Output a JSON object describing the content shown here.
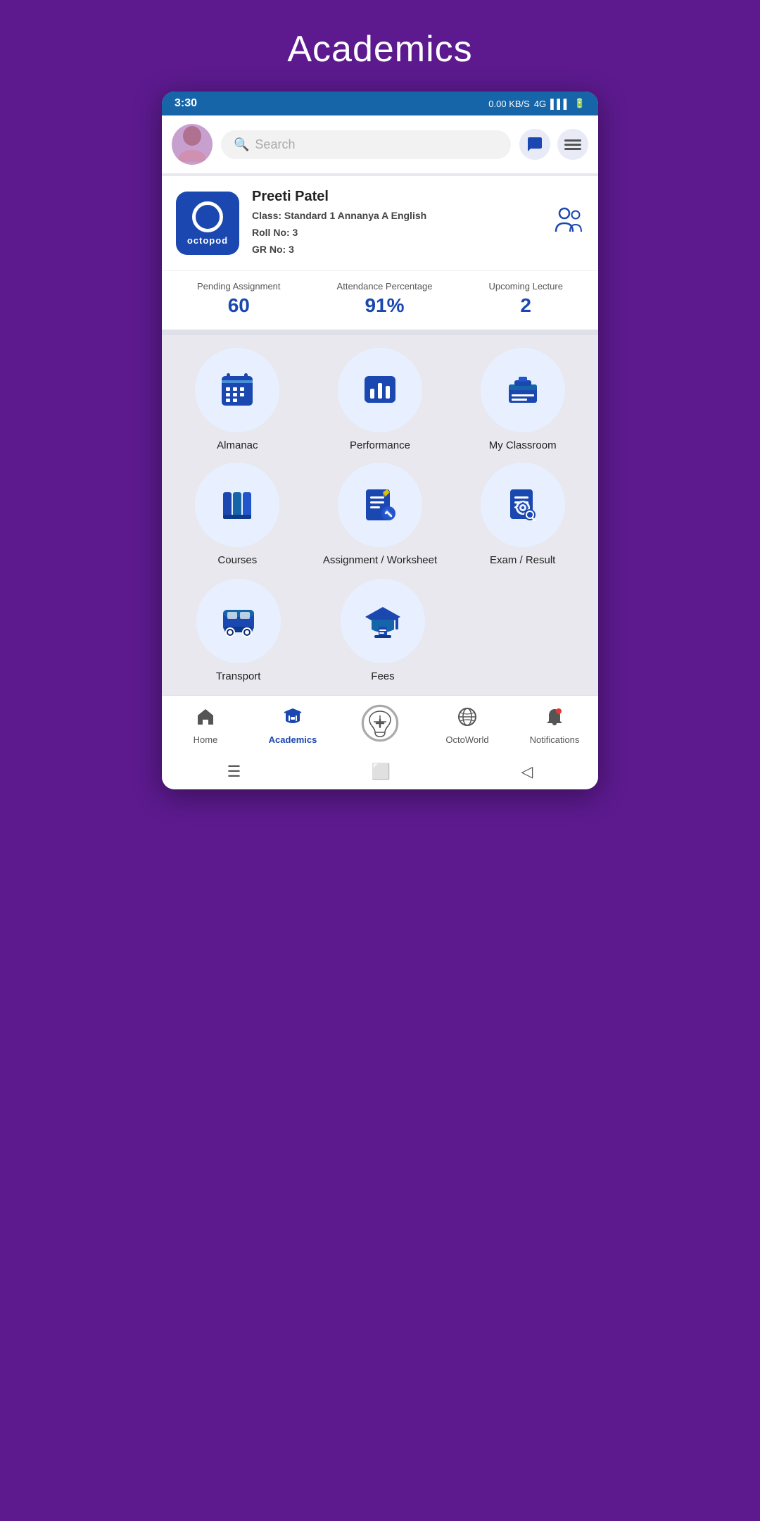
{
  "page": {
    "title": "Academics"
  },
  "status_bar": {
    "time": "3:30",
    "speed": "0.00 KB/S",
    "network": "4G"
  },
  "search": {
    "placeholder": "Search"
  },
  "profile": {
    "name": "Preeti Patel",
    "class_label": "Class:",
    "class_value": "Standard 1 Annanya A English",
    "roll_label": "Roll No:",
    "roll_value": "3",
    "gr_label": "GR No:",
    "gr_value": "3",
    "logo_text": "octopod"
  },
  "stats": [
    {
      "label": "Pending Assignment",
      "value": "60"
    },
    {
      "label": "Attendance Percentage",
      "value": "91%"
    },
    {
      "label": "Upcoming Lecture",
      "value": "2"
    }
  ],
  "grid_items": [
    {
      "id": "almanac",
      "label": "Almanac"
    },
    {
      "id": "performance",
      "label": "Performance"
    },
    {
      "id": "my-classroom",
      "label": "My Classroom"
    },
    {
      "id": "courses",
      "label": "Courses"
    },
    {
      "id": "assignment-worksheet",
      "label": "Assignment / Worksheet"
    },
    {
      "id": "exam-result",
      "label": "Exam / Result"
    }
  ],
  "bottom_grid_items": [
    {
      "id": "transport",
      "label": "Transport"
    },
    {
      "id": "fees",
      "label": "Fees"
    }
  ],
  "bottom_nav": [
    {
      "id": "home",
      "label": "Home",
      "active": false
    },
    {
      "id": "academics",
      "label": "Academics",
      "active": true
    },
    {
      "id": "octoworld-plus",
      "label": "",
      "active": false
    },
    {
      "id": "octoworld",
      "label": "OctoWorld",
      "active": false
    },
    {
      "id": "notifications",
      "label": "Notifications",
      "active": false
    }
  ]
}
